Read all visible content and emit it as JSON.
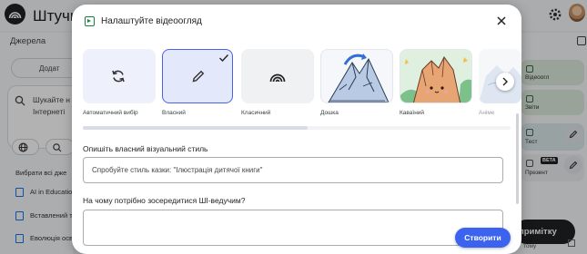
{
  "app": {
    "title": "Штучн",
    "sources_title": "Джерела",
    "add_label": "Додат",
    "search_prompt": "Шукайте н",
    "search_prompt_2": "Інтернеті",
    "select_all": "Вибрати всі дже",
    "sources": [
      {
        "label": "AI in Educatio"
      },
      {
        "label": "Вставлений т"
      },
      {
        "label": "Еволюція осв"
      }
    ],
    "studio": {
      "cards": [
        {
          "label": "Відеоогл",
          "color": "#dbeadb"
        },
        {
          "label": "Звіти",
          "color": "#dbeadb"
        },
        {
          "label": "Тест",
          "color": "#dce9ea"
        },
        {
          "label": "Презент",
          "color": "#eceef0"
        }
      ],
      "beta_badge": "BETA",
      "note_button": "примітку",
      "note_sub": "тому"
    }
  },
  "dialog": {
    "title": "Налаштуйте відеоогляд",
    "styles": [
      {
        "label": "Автоматичний вибір",
        "icon": "refresh-icon",
        "selected": false
      },
      {
        "label": "Власний",
        "icon": "pencil-icon",
        "selected": true
      },
      {
        "label": "Класичний",
        "icon": "rainbow-logo-icon",
        "selected": false
      },
      {
        "label": "Дошка",
        "icon": "whiteboard-illustration",
        "selected": false
      },
      {
        "label": "Каваїний",
        "icon": "kawaii-illustration",
        "selected": false
      },
      {
        "label": "Аніме",
        "icon": "anime-illustration",
        "selected": false
      }
    ],
    "custom_style": {
      "label": "Опишіть власний візуальний стиль",
      "placeholder": "Спробуйте стиль казки: \"Ілюстрація дитячої книги\""
    },
    "focus": {
      "label": "На чому потрібно зосередитися ШІ-ведучим?",
      "value": ""
    },
    "create_button": "Створити",
    "accent_color": "#3b63f0",
    "selected_border_color": "#4a63e0"
  }
}
